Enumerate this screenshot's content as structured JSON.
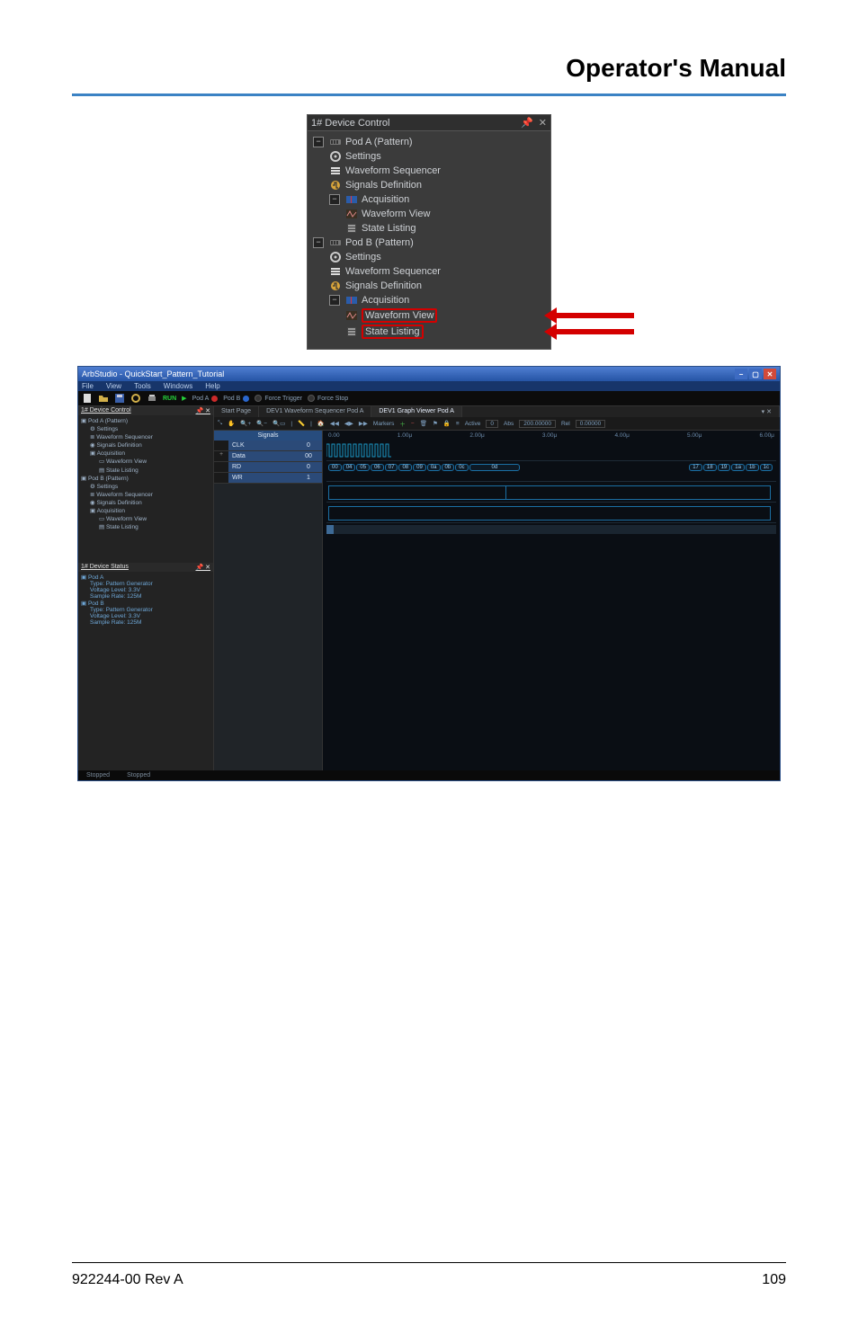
{
  "header_title": "Operator's Manual",
  "footer_left": "922244-00 Rev A",
  "footer_right": "109",
  "fig1": {
    "title": "1# Device Control",
    "pin_glyph": "📌",
    "close_glyph": "✕",
    "podA": {
      "label": "Pod A (Pattern)",
      "settings": "Settings",
      "seq": "Waveform Sequencer",
      "sigdef": "Signals Definition",
      "acq": "Acquisition",
      "wave": "Waveform View",
      "state": "State Listing"
    },
    "podB": {
      "label": "Pod B (Pattern)",
      "settings": "Settings",
      "seq": "Waveform Sequencer",
      "sigdef": "Signals Definition",
      "acq": "Acquisition",
      "wave": "Waveform View",
      "state": "State Listing"
    }
  },
  "fig2": {
    "title": "ArbStudio - QuickStart_Pattern_Tutorial",
    "menus": [
      "File",
      "View",
      "Tools",
      "Windows",
      "Help"
    ],
    "toolbar": {
      "run_label": "RUN",
      "podA_label": "Pod A",
      "podB_label": "Pod B",
      "trig1": "Force Trigger",
      "trig2": "Force Stop"
    },
    "left_panel": {
      "title": "1# Device Control",
      "podA": {
        "label": "Pod A (Pattern)",
        "settings": "Settings",
        "seq": "Waveform Sequencer",
        "sigdef": "Signals Definition",
        "acq": "Acquisition",
        "wave": "Waveform View",
        "state": "State Listing"
      },
      "podB": {
        "label": "Pod B (Pattern)",
        "settings": "Settings",
        "seq": "Waveform Sequencer",
        "sigdef": "Signals Definition",
        "acq": "Acquisition",
        "wave": "Waveform View",
        "state": "State Listing"
      },
      "status_title": "1# Device Status",
      "status_podA": {
        "label": "Pod A",
        "type": "Type: Pattern Generator",
        "volt": "Voltage Level: 3.3V",
        "rate": "Sample Rate: 125M"
      },
      "status_podB": {
        "label": "Pod B",
        "type": "Type: Pattern Generator",
        "volt": "Voltage Level: 3.3V",
        "rate": "Sample Rate: 125M"
      }
    },
    "tabs": {
      "t1": "Start Page",
      "t2": "DEV1 Waveform Sequencer Pod A",
      "t3": "DEV1 Graph Viewer Pod A"
    },
    "graph_toolbar": {
      "markers": "Markers",
      "active_lbl": "Active",
      "active_val": "0",
      "abs_lbl": "Abs",
      "abs_val": "200.00000",
      "rel_lbl": "Rel",
      "rel_val": "0.00000"
    },
    "time_ticks": [
      "0.00",
      "1.00μ",
      "2.00μ",
      "3.00μ",
      "4.00μ",
      "5.00μ",
      "6.00μ"
    ],
    "signals": {
      "header": "Signals",
      "rows": [
        {
          "name": "CLK",
          "val": "0"
        },
        {
          "name": "Data",
          "val": "00"
        },
        {
          "name": "RD",
          "val": "0"
        },
        {
          "name": "WR",
          "val": "1"
        }
      ],
      "plus_glyph": "+"
    },
    "hex_values_left": [
      "00",
      "04",
      "05",
      "06",
      "07",
      "08",
      "09",
      "0a",
      "0b",
      "0c"
    ],
    "hex_value_mid": "0d",
    "hex_values_right": [
      "17",
      "18",
      "19",
      "1a",
      "1b",
      "1c"
    ],
    "status": {
      "s1": "Stopped",
      "s2": "Stopped"
    }
  }
}
